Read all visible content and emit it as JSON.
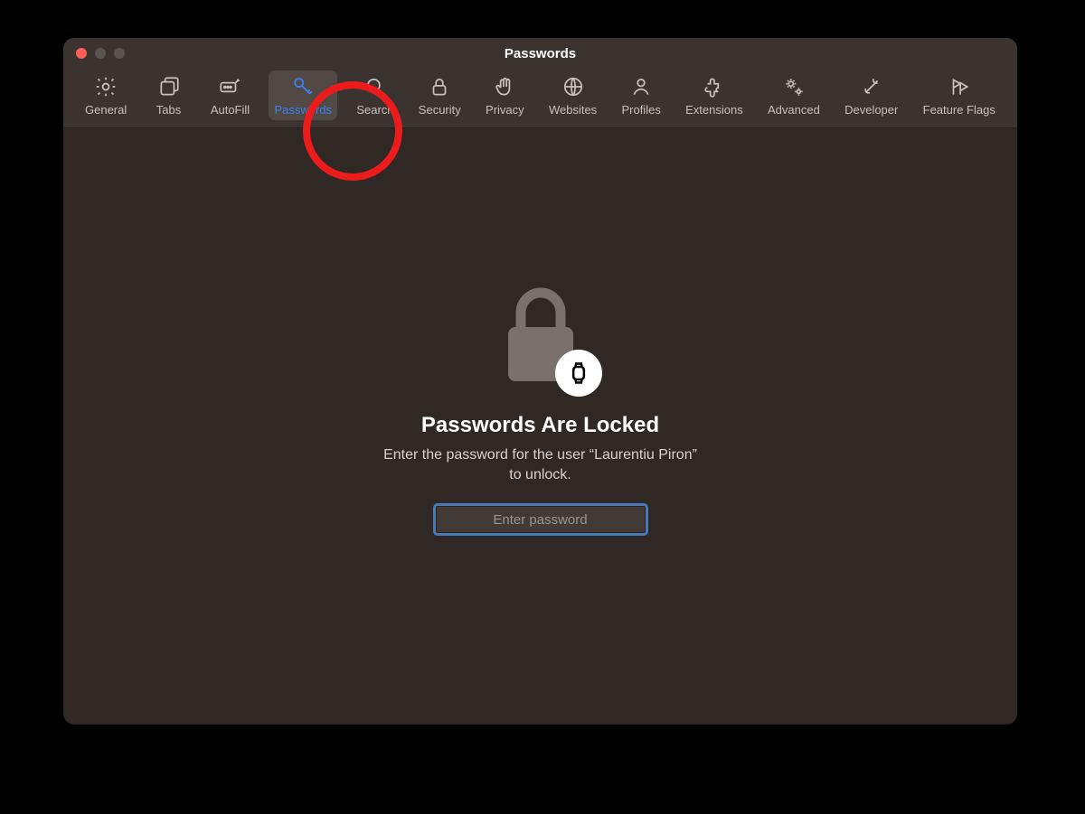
{
  "window": {
    "title": "Passwords"
  },
  "toolbar": {
    "items": [
      {
        "id": "general",
        "label": "General"
      },
      {
        "id": "tabs",
        "label": "Tabs"
      },
      {
        "id": "autofill",
        "label": "AutoFill"
      },
      {
        "id": "passwords",
        "label": "Passwords",
        "selected": true
      },
      {
        "id": "search",
        "label": "Search"
      },
      {
        "id": "security",
        "label": "Security"
      },
      {
        "id": "privacy",
        "label": "Privacy"
      },
      {
        "id": "websites",
        "label": "Websites"
      },
      {
        "id": "profiles",
        "label": "Profiles"
      },
      {
        "id": "extensions",
        "label": "Extensions"
      },
      {
        "id": "advanced",
        "label": "Advanced"
      },
      {
        "id": "developer",
        "label": "Developer"
      },
      {
        "id": "featureflags",
        "label": "Feature Flags"
      }
    ]
  },
  "locked": {
    "title": "Passwords Are Locked",
    "subtitle": "Enter the password for the user “Laurentiu Piron” to unlock.",
    "placeholder": "Enter password"
  },
  "annotation": {
    "highlight_tab": "passwords",
    "ring_color": "#ed1c1c"
  }
}
